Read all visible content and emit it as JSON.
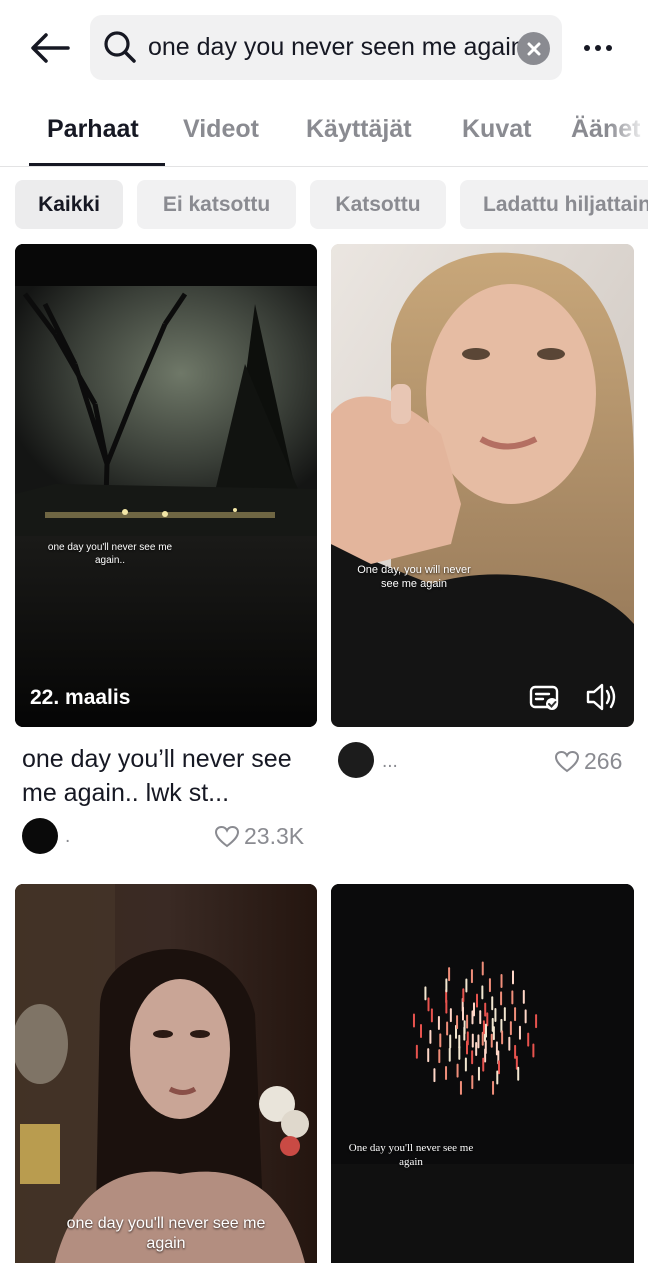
{
  "search": {
    "query": "one day you never seen me again"
  },
  "tabs": [
    {
      "label": "Parhaat"
    },
    {
      "label": "Videot"
    },
    {
      "label": "Käyttäjät"
    },
    {
      "label": "Kuvat"
    },
    {
      "label": "Äänet"
    }
  ],
  "filters": [
    {
      "label": "Kaikki"
    },
    {
      "label": "Ei katsottu"
    },
    {
      "label": "Katsottu"
    },
    {
      "label": "Ladattu hiljattain"
    }
  ],
  "videos": [
    {
      "overlay_text": "one day you'll never see me again..",
      "date": "22. maalis",
      "description": "one day you’ll never see me again.. lwk st...",
      "username": ".",
      "likes": "23.3K"
    },
    {
      "overlay_text": "One day, you will never see me again",
      "description": "",
      "username": "...",
      "likes": "266"
    },
    {
      "overlay_text": "one day you'll never see me again"
    },
    {
      "overlay_text": "One day you'll never see me again"
    }
  ],
  "colors": {
    "primary_text": "#161823",
    "secondary_text": "#8a8b91",
    "chip_bg": "#f1f1f2"
  }
}
